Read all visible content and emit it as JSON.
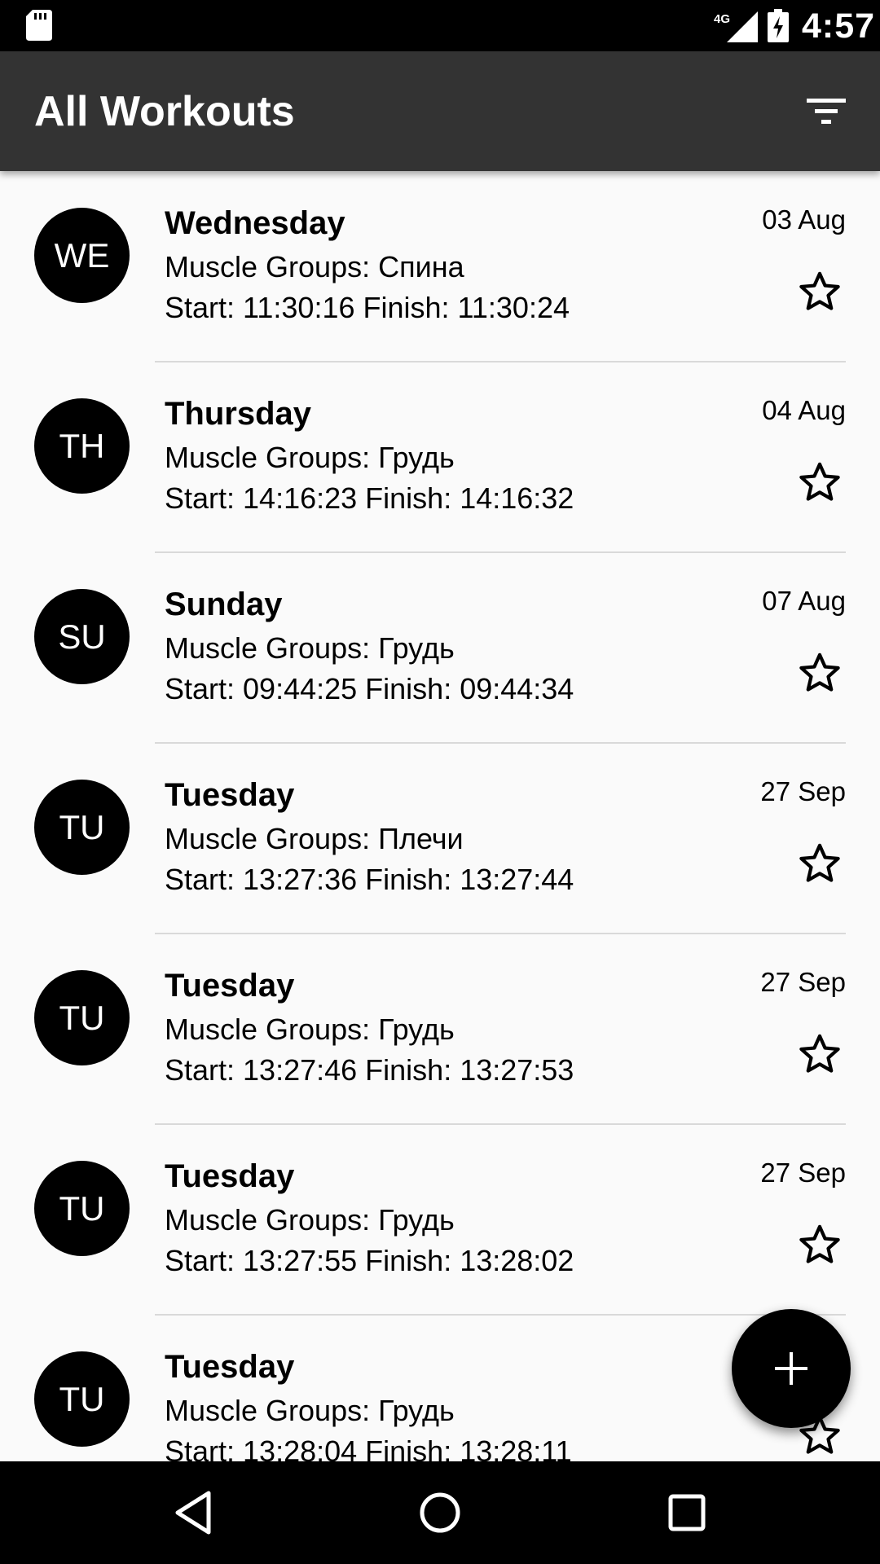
{
  "status_bar": {
    "time": "4:57",
    "network": "4G",
    "icons": [
      "sd-card-icon",
      "signal-icon",
      "battery-charging-icon"
    ]
  },
  "app_bar": {
    "title": "All Workouts",
    "filter_icon": "filter-icon"
  },
  "workouts": [
    {
      "initials": "WE",
      "day": "Wednesday",
      "muscle_groups": "Muscle Groups: Спина",
      "times": "Start: 11:30:16 Finish: 11:30:24",
      "date": "03 Aug",
      "starred": false
    },
    {
      "initials": "TH",
      "day": "Thursday",
      "muscle_groups": "Muscle Groups: Грудь",
      "times": "Start: 14:16:23 Finish: 14:16:32",
      "date": "04 Aug",
      "starred": false
    },
    {
      "initials": "SU",
      "day": "Sunday",
      "muscle_groups": "Muscle Groups: Грудь",
      "times": "Start: 09:44:25 Finish: 09:44:34",
      "date": "07 Aug",
      "starred": false
    },
    {
      "initials": "TU",
      "day": "Tuesday",
      "muscle_groups": "Muscle Groups: Плечи",
      "times": "Start: 13:27:36 Finish: 13:27:44",
      "date": "27 Sep",
      "starred": false
    },
    {
      "initials": "TU",
      "day": "Tuesday",
      "muscle_groups": "Muscle Groups: Грудь",
      "times": "Start: 13:27:46 Finish: 13:27:53",
      "date": "27 Sep",
      "starred": false
    },
    {
      "initials": "TU",
      "day": "Tuesday",
      "muscle_groups": "Muscle Groups: Грудь",
      "times": "Start: 13:27:55 Finish: 13:28:02",
      "date": "27 Sep",
      "starred": false
    },
    {
      "initials": "TU",
      "day": "Tuesday",
      "muscle_groups": "Muscle Groups: Грудь",
      "times": "Start: 13:28:04 Finish: 13:28:11",
      "date": "",
      "starred": false
    }
  ],
  "fab": {
    "icon": "plus-icon"
  },
  "nav_bar": {
    "icons": [
      "back-icon",
      "home-icon",
      "recents-icon"
    ]
  }
}
